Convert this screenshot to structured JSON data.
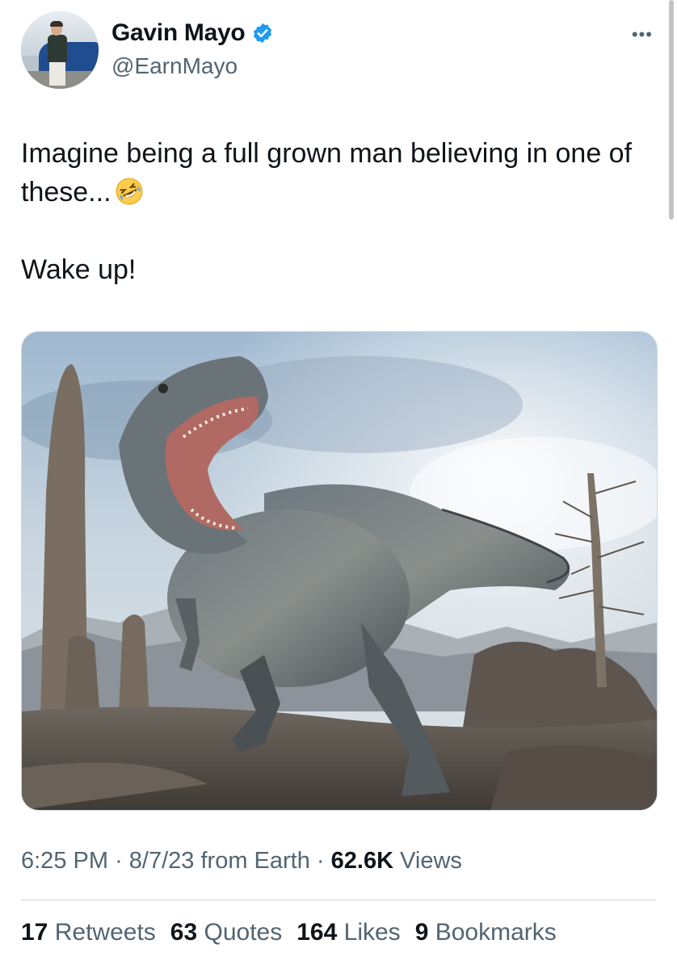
{
  "author": {
    "name": "Gavin Mayo",
    "handle": "@EarnMayo",
    "verified": true,
    "verified_color": "#1d9bf0"
  },
  "tweet": {
    "line1": "Imagine being a full grown man believing in one of these...",
    "emoji": "rolling-on-the-floor-laughing-emoji",
    "line2": "Wake up!"
  },
  "meta": {
    "time": "6:25 PM",
    "date": "8/7/23",
    "source": "from Earth",
    "views_count": "62.6K",
    "views_label": "Views"
  },
  "stats": [
    {
      "count": "17",
      "label": "Retweets"
    },
    {
      "count": "63",
      "label": "Quotes"
    },
    {
      "count": "164",
      "label": "Likes"
    },
    {
      "count": "9",
      "label": "Bookmarks"
    }
  ]
}
